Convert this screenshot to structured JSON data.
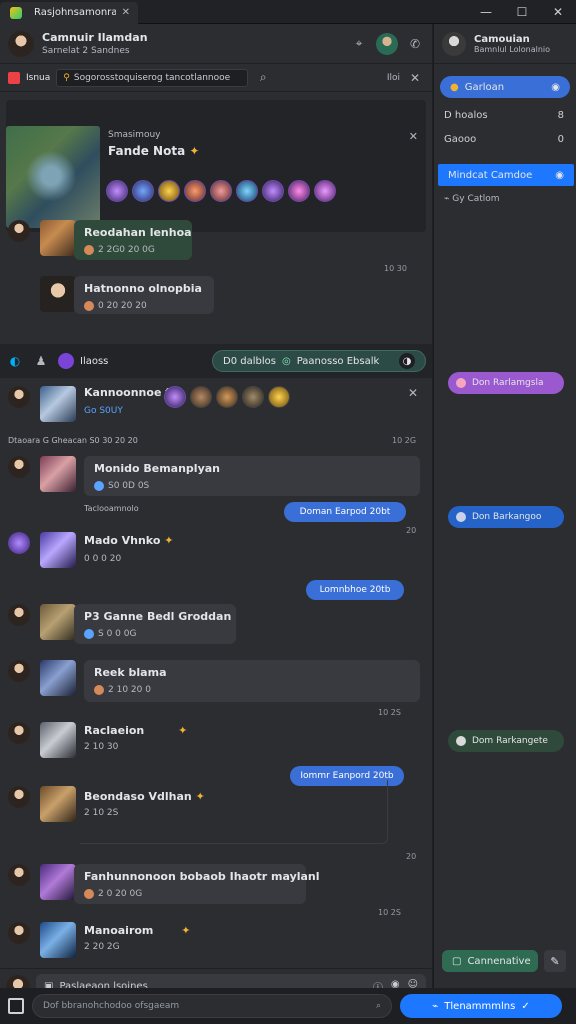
{
  "window": {
    "tab_title": "Rasjohnsamonran",
    "controls": [
      "—",
      "☐",
      "✕"
    ]
  },
  "chat_header": {
    "name": "Camnuir Ilamdan",
    "status": "Sarnelat 2 Sandnes"
  },
  "search": {
    "label": "Isnua",
    "placeholder": "Sogorosstoquiserog tancotlannooe",
    "right_label": "Iloi"
  },
  "pinned_card": {
    "small": "Smasimouy",
    "title": "Fande Nota"
  },
  "messages": [
    {
      "title": "Reodahan lenhoa",
      "sub": "2 2G0 20 0G"
    },
    {
      "title": "Hatnonno olnopbia",
      "sub": "0 20 20 20"
    },
    {
      "title": "Kannoonnoe fnr",
      "sub": "Go S0UY"
    },
    {
      "title": "Monido Bemanplyan",
      "sub": "S0 0D 0S"
    },
    {
      "title": "Mado Vhnko",
      "sub": "0 0 0 20"
    },
    {
      "title": "P3 Ganne Bedl Groddan",
      "sub": "S 0 0 0G"
    },
    {
      "title": "Reek blama",
      "sub": "2 10 20 0"
    },
    {
      "title": "Raclaeion",
      "sub": "2 10 30"
    },
    {
      "title": "Beondaso Vdlhan",
      "sub": "2 10 2S"
    },
    {
      "title": "Fanhunnonoon bobaob Ihaotr maylanl",
      "sub": "2 0 20 0G"
    },
    {
      "title": "Manoairom",
      "sub": "2 20 2G"
    }
  ],
  "timestamps": [
    "10 30",
    "10 2G",
    "S 20",
    "20",
    "10 2S",
    "20",
    "10 2S",
    "10 2S"
  ],
  "section_label": "Dtaoara  G Gheacan  S0 30 20 20",
  "toolbar": {
    "left_pill": "Ilaoss",
    "right_pill_a": "D0 dalblos",
    "right_pill_b": "Paanosso Ebsalk"
  },
  "sub_line": "Taclooamnolo",
  "outgoing": [
    "Doman Earpod 20bt",
    "Lomnbhoe 20tb",
    "Iommr Eanpord 20tb"
  ],
  "composer": {
    "placeholder": "Paslaeaon lsoines"
  },
  "bottom": {
    "placeholder": "Dof bbranohchodoo ofsgaeam",
    "send_label": "Tlenammmlns"
  },
  "sidebar": {
    "profile_name": "Camouian",
    "profile_sub": "Bamnlul Lolonalnio",
    "btn_primary": "Garloan",
    "row1_label": "D hoalos",
    "row1_count": "8",
    "row2_label": "Gaooo",
    "row2_count": "0",
    "btn_secondary": "Mindcat Camdoe",
    "link": "Gy Catlom",
    "tag1": "Don Rarlamgsla",
    "tag2": "Don Barkangoo",
    "tag3": "Dom Rarkangete",
    "action": "Cannenative"
  }
}
